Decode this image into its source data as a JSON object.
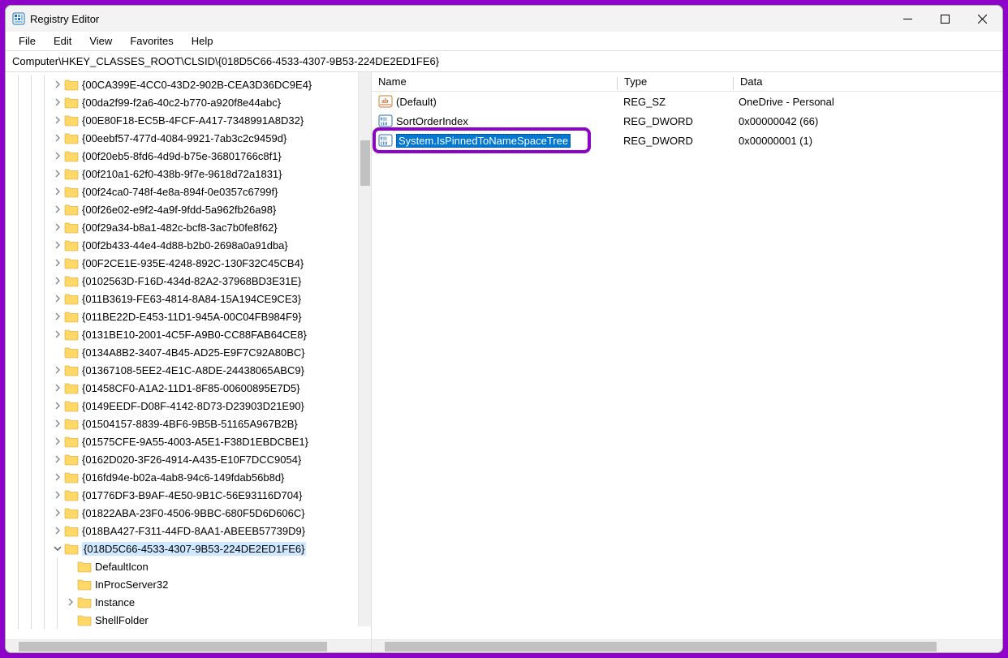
{
  "app": {
    "title": "Registry Editor"
  },
  "menu": {
    "file": "File",
    "edit": "Edit",
    "view": "View",
    "favorites": "Favorites",
    "help": "Help"
  },
  "address": "Computer\\HKEY_CLASSES_ROOT\\CLSID\\{018D5C66-4533-4307-9B53-224DE2ED1FE6}",
  "columns": {
    "name": "Name",
    "type": "Type",
    "data": "Data"
  },
  "tree": {
    "items": [
      {
        "label": "{00CA399E-4CC0-43D2-902B-CEA3D36DC9E4}",
        "expander": "closed",
        "depth": 3
      },
      {
        "label": "{00da2f99-f2a6-40c2-b770-a920f8e44abc}",
        "expander": "closed",
        "depth": 3
      },
      {
        "label": "{00E80F18-EC5B-4FCF-A417-7348991A8D32}",
        "expander": "closed",
        "depth": 3
      },
      {
        "label": "{00eebf57-477d-4084-9921-7ab3c2c9459d}",
        "expander": "closed",
        "depth": 3
      },
      {
        "label": "{00f20eb5-8fd6-4d9d-b75e-36801766c8f1}",
        "expander": "closed",
        "depth": 3
      },
      {
        "label": "{00f210a1-62f0-438b-9f7e-9618d72a1831}",
        "expander": "closed",
        "depth": 3
      },
      {
        "label": "{00f24ca0-748f-4e8a-894f-0e0357c6799f}",
        "expander": "closed",
        "depth": 3
      },
      {
        "label": "{00f26e02-e9f2-4a9f-9fdd-5a962fb26a98}",
        "expander": "closed",
        "depth": 3
      },
      {
        "label": "{00f29a34-b8a1-482c-bcf8-3ac7b0fe8f62}",
        "expander": "closed",
        "depth": 3
      },
      {
        "label": "{00f2b433-44e4-4d88-b2b0-2698a0a91dba}",
        "expander": "closed",
        "depth": 3
      },
      {
        "label": "{00F2CE1E-935E-4248-892C-130F32C45CB4}",
        "expander": "closed",
        "depth": 3
      },
      {
        "label": "{0102563D-F16D-434d-82A2-37968BD3E31E}",
        "expander": "closed",
        "depth": 3
      },
      {
        "label": "{011B3619-FE63-4814-8A84-15A194CE9CE3}",
        "expander": "closed",
        "depth": 3
      },
      {
        "label": "{011BE22D-E453-11D1-945A-00C04FB984F9}",
        "expander": "closed",
        "depth": 3
      },
      {
        "label": "{0131BE10-2001-4C5F-A9B0-CC88FAB64CE8}",
        "expander": "closed",
        "depth": 3
      },
      {
        "label": "{0134A8B2-3407-4B45-AD25-E9F7C92A80BC}",
        "expander": "none",
        "depth": 3
      },
      {
        "label": "{01367108-5EE2-4E1C-A8DE-24438065ABC9}",
        "expander": "closed",
        "depth": 3
      },
      {
        "label": "{01458CF0-A1A2-11D1-8F85-00600895E7D5}",
        "expander": "closed",
        "depth": 3
      },
      {
        "label": "{0149EEDF-D08F-4142-8D73-D23903D21E90}",
        "expander": "closed",
        "depth": 3
      },
      {
        "label": "{01504157-8839-4BF6-9B5B-51165A967B2B}",
        "expander": "closed",
        "depth": 3
      },
      {
        "label": "{01575CFE-9A55-4003-A5E1-F38D1EBDCBE1}",
        "expander": "closed",
        "depth": 3
      },
      {
        "label": "{0162D020-3F26-4914-A435-E10F7DCC9054}",
        "expander": "closed",
        "depth": 3
      },
      {
        "label": "{016fd94e-b02a-4ab8-94c6-149fdab56b8d}",
        "expander": "closed",
        "depth": 3
      },
      {
        "label": "{01776DF3-B9AF-4E50-9B1C-56E93116D704}",
        "expander": "closed",
        "depth": 3
      },
      {
        "label": "{01822ABA-23F0-4506-9BBC-680F5D6D606C}",
        "expander": "closed",
        "depth": 3
      },
      {
        "label": "{018BA427-F311-44FD-8AA1-ABEEB57739D9}",
        "expander": "closed",
        "depth": 3
      },
      {
        "label": "{018D5C66-4533-4307-9B53-224DE2ED1FE6}",
        "expander": "open",
        "depth": 3,
        "selected": true
      },
      {
        "label": "DefaultIcon",
        "expander": "none",
        "depth": 4
      },
      {
        "label": "InProcServer32",
        "expander": "none",
        "depth": 4
      },
      {
        "label": "Instance",
        "expander": "closed",
        "depth": 4
      },
      {
        "label": "ShellFolder",
        "expander": "none",
        "depth": 4
      }
    ]
  },
  "values": [
    {
      "name": "(Default)",
      "type": "REG_SZ",
      "data": "OneDrive - Personal",
      "icon": "sz"
    },
    {
      "name": "SortOrderIndex",
      "type": "REG_DWORD",
      "data": "0x00000042 (66)",
      "icon": "dw"
    },
    {
      "name": "System.IsPinnedToNameSpaceTree",
      "type": "REG_DWORD",
      "data": "0x00000001 (1)",
      "icon": "dw",
      "selected": true
    }
  ]
}
